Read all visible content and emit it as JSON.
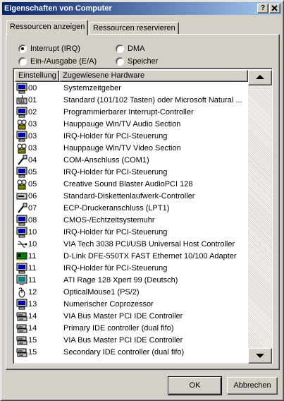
{
  "window": {
    "title": "Eigenschaften von Computer",
    "help_button": "?",
    "close_button": "x"
  },
  "tabs": [
    {
      "label": "Ressourcen anzeigen",
      "active": true
    },
    {
      "label": "Ressourcen reservieren",
      "active": false
    }
  ],
  "view_options": {
    "selected": "irq",
    "options": [
      {
        "key": "irq",
        "label": "Interrupt (IRQ)"
      },
      {
        "key": "io",
        "label": "Ein-/Ausgabe (E/A)"
      },
      {
        "key": "dma",
        "label": "DMA"
      },
      {
        "key": "memory",
        "label": "Speicher"
      }
    ]
  },
  "resource_list": {
    "columns": [
      "Einstellung",
      "Zugewiesene Hardware"
    ],
    "rows": [
      {
        "icon": "computer-icon",
        "setting": "00",
        "hardware": "Systemzeitgeber"
      },
      {
        "icon": "keyboard-icon",
        "setting": "01",
        "hardware": "Standard (101/102 Tasten) oder Microsoft Natural ..."
      },
      {
        "icon": "computer-icon",
        "setting": "02",
        "hardware": "Programmierbarer Interrupt-Controller"
      },
      {
        "icon": "multimedia-icon",
        "setting": "03",
        "hardware": "Hauppauge Win/TV Audio Section"
      },
      {
        "icon": "computer-icon",
        "setting": "03",
        "hardware": "IRQ-Holder für PCI-Steuerung"
      },
      {
        "icon": "multimedia-icon",
        "setting": "03",
        "hardware": "Hauppauge Win/TV Video Section"
      },
      {
        "icon": "port-icon",
        "setting": "04",
        "hardware": "COM-Anschluss (COM1)"
      },
      {
        "icon": "computer-icon",
        "setting": "05",
        "hardware": "IRQ-Holder für PCI-Steuerung"
      },
      {
        "icon": "multimedia-icon",
        "setting": "05",
        "hardware": "Creative Sound Blaster AudioPCI 128"
      },
      {
        "icon": "floppy-controller-icon",
        "setting": "06",
        "hardware": "Standard-Diskettenlaufwerk-Controller"
      },
      {
        "icon": "port-icon",
        "setting": "07",
        "hardware": "ECP-Druckeranschluss (LPT1)"
      },
      {
        "icon": "computer-icon",
        "setting": "08",
        "hardware": "CMOS-/Echtzeitsystemuhr"
      },
      {
        "icon": "computer-icon",
        "setting": "10",
        "hardware": "IRQ-Holder für PCI-Steuerung"
      },
      {
        "icon": "usb-icon",
        "setting": "10",
        "hardware": "VIA Tech 3038 PCI/USB Universal Host Controller"
      },
      {
        "icon": "network-card-icon",
        "setting": "11",
        "hardware": "D-Link DFE-550TX FAST Ethernet 10/100 Adapter"
      },
      {
        "icon": "computer-icon",
        "setting": "11",
        "hardware": "IRQ-Holder für PCI-Steuerung"
      },
      {
        "icon": "display-icon",
        "setting": "11",
        "hardware": "ATI Rage 128 Xpert 99 (Deutsch)"
      },
      {
        "icon": "mouse-icon",
        "setting": "12",
        "hardware": "OpticalMouse1 (PS/2)"
      },
      {
        "icon": "computer-icon",
        "setting": "13",
        "hardware": "Numerischer Coprozessor"
      },
      {
        "icon": "ide-controller-icon",
        "setting": "14",
        "hardware": "VIA Bus Master PCI IDE Controller"
      },
      {
        "icon": "ide-controller-icon",
        "setting": "14",
        "hardware": "Primary IDE controller (dual fifo)"
      },
      {
        "icon": "ide-controller-icon",
        "setting": "15",
        "hardware": "VIA Bus Master PCI IDE Controller"
      },
      {
        "icon": "ide-controller-icon",
        "setting": "15",
        "hardware": "Secondary IDE controller (dual fifo)"
      }
    ]
  },
  "buttons": {
    "ok": "OK",
    "cancel": "Abbrechen"
  }
}
